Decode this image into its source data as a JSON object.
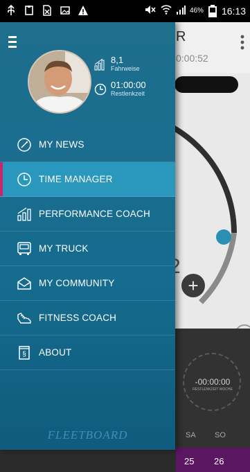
{
  "status_bar": {
    "battery_percent": "46%",
    "time": "16:13",
    "icons": [
      "usb-icon",
      "clipboard-icon",
      "no-sim-icon",
      "image-icon",
      "warning-icon",
      "mute-icon",
      "wifi-icon",
      "signal-icon",
      "battery-icon"
    ]
  },
  "background": {
    "title_fragment": "R",
    "timer": "0:00:52",
    "dial_time": "-00:00:00",
    "dial_sub": "RESTLENKZEIT WOCHE",
    "big_digit": "2",
    "days": [
      "SA",
      "SO"
    ],
    "dates": [
      "25",
      "26"
    ],
    "plus_label": "+"
  },
  "profile": {
    "fahrweise_value": "8,1",
    "fahrweise_label": "Fahrweise",
    "restlenkzeit_value": "01:00:00",
    "restlenkzeit_label": "Restlenkzeit"
  },
  "menu": {
    "items": [
      {
        "label": "MY NEWS",
        "icon": "gauge-icon"
      },
      {
        "label": "TIME MANAGER",
        "icon": "clock-icon"
      },
      {
        "label": "PERFORMANCE COACH",
        "icon": "bars-icon"
      },
      {
        "label": "MY TRUCK",
        "icon": "truck-icon"
      },
      {
        "label": "MY COMMUNITY",
        "icon": "envelope-icon"
      },
      {
        "label": "FITNESS COACH",
        "icon": "shoe-icon"
      },
      {
        "label": "ABOUT",
        "icon": "info-icon"
      }
    ],
    "active_index": 1
  },
  "brand": "FLEETBOARD",
  "colors": {
    "drawer": "#1a6d8f",
    "active_item": "#2a97bd",
    "active_marker": "#c8256a",
    "accent_dot": "#2a8fb3",
    "calendar_purple": "#5a1660"
  }
}
